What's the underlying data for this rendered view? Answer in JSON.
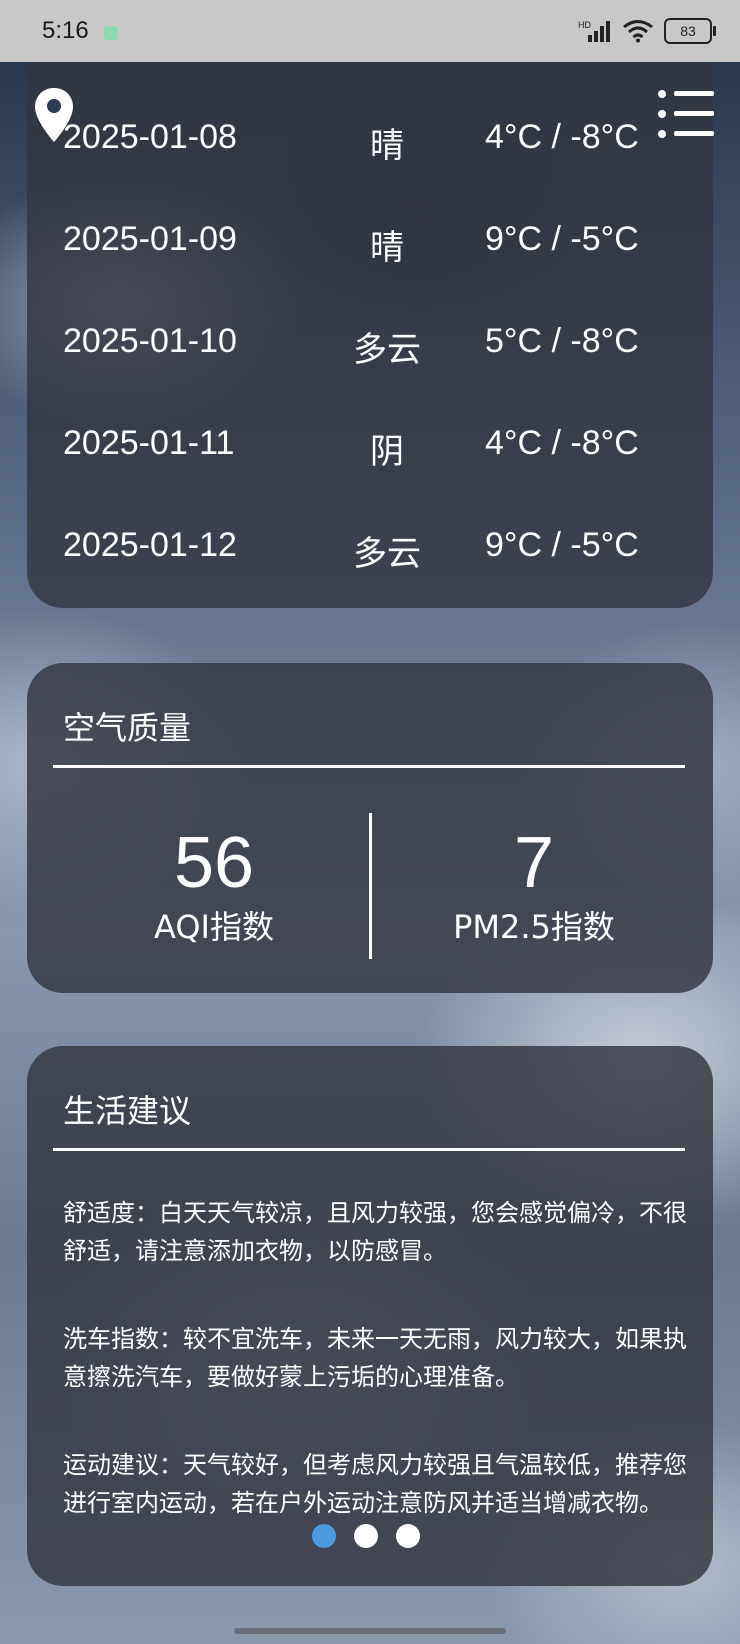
{
  "status_bar": {
    "time": "5:16",
    "battery": "83",
    "network_label": "HD"
  },
  "forecast": [
    {
      "date": "2025-01-08",
      "condition": "晴",
      "temp": "4°C / -8°C"
    },
    {
      "date": "2025-01-09",
      "condition": "晴",
      "temp": "9°C / -5°C"
    },
    {
      "date": "2025-01-10",
      "condition": "多云",
      "temp": "5°C / -8°C"
    },
    {
      "date": "2025-01-11",
      "condition": "阴",
      "temp": "4°C / -8°C"
    },
    {
      "date": "2025-01-12",
      "condition": "多云",
      "temp": "9°C / -5°C"
    }
  ],
  "air_quality": {
    "title": "空气质量",
    "aqi_value": "56",
    "aqi_label": "AQI指数",
    "pm25_value": "7",
    "pm25_label": "PM2.5指数"
  },
  "life_advice": {
    "title": "生活建议",
    "items": [
      "舒适度：白天天气较凉，且风力较强，您会感觉偏冷，不很舒适，请注意添加衣物，以防感冒。",
      "洗车指数：较不宜洗车，未来一天无雨，风力较大，如果执意擦洗汽车，要做好蒙上污垢的心理准备。",
      "运动建议：天气较好，但考虑风力较强且气温较低，推荐您进行室内运动，若在户外运动注意防风并适当增减衣物。"
    ],
    "pages": 3,
    "active_page": 1
  },
  "colors": {
    "card_bg": "#32364a",
    "active_dot": "#4a9be0",
    "text": "#ffffff"
  },
  "icons": {
    "location": "location-pin-icon",
    "menu": "menu-list-icon"
  }
}
